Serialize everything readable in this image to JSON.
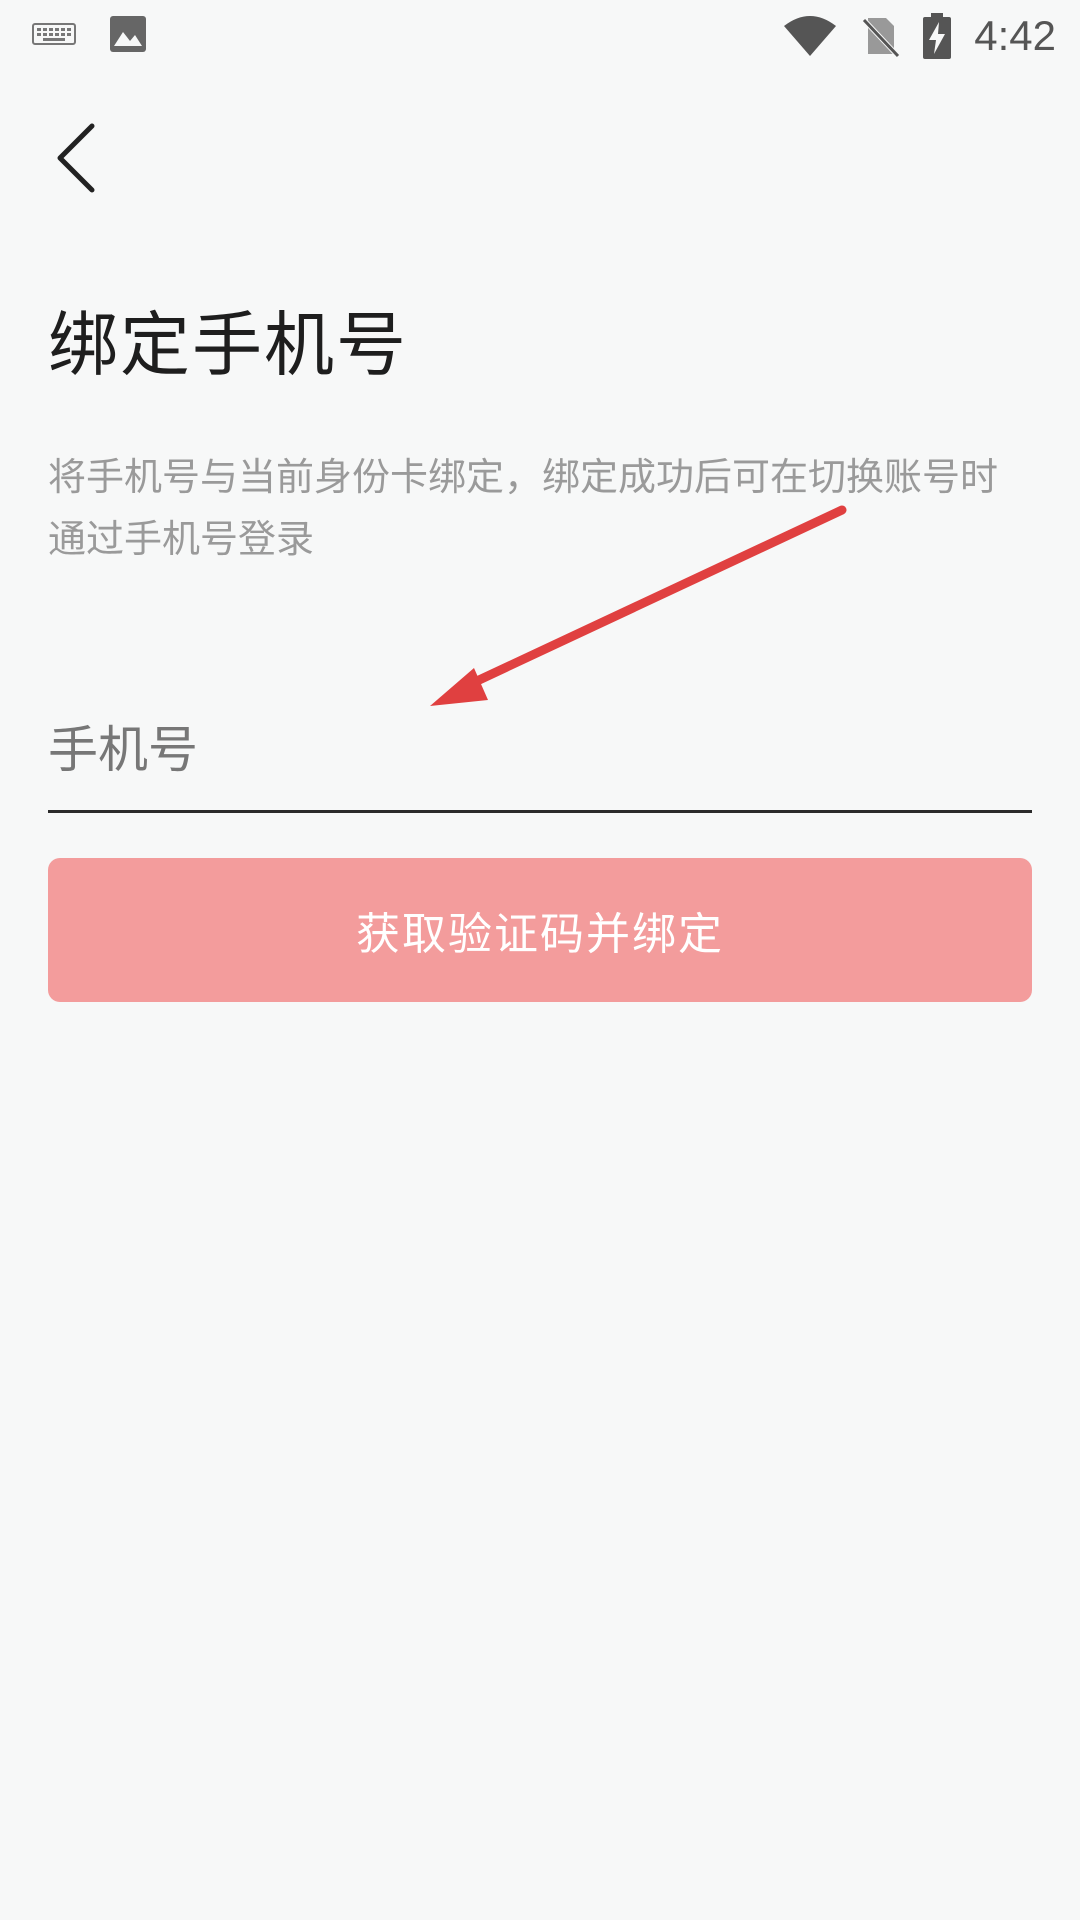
{
  "status_bar": {
    "time": "4:42",
    "icons": [
      "keyboard-icon",
      "image-icon",
      "wifi-icon",
      "no-sim-icon",
      "battery-charging-icon"
    ]
  },
  "header": {
    "back_icon": "chevron-left-icon"
  },
  "main": {
    "title": "绑定手机号",
    "description": "将手机号与当前身份卡绑定，绑定成功后可在切换账号时通过手机号登录",
    "phone_input": {
      "value": "",
      "placeholder": "手机号"
    },
    "bind_button_label": "获取验证码并绑定"
  },
  "colors": {
    "background": "#f7f8f8",
    "button": "#f39c9c",
    "annotation_arrow": "#e04040"
  }
}
